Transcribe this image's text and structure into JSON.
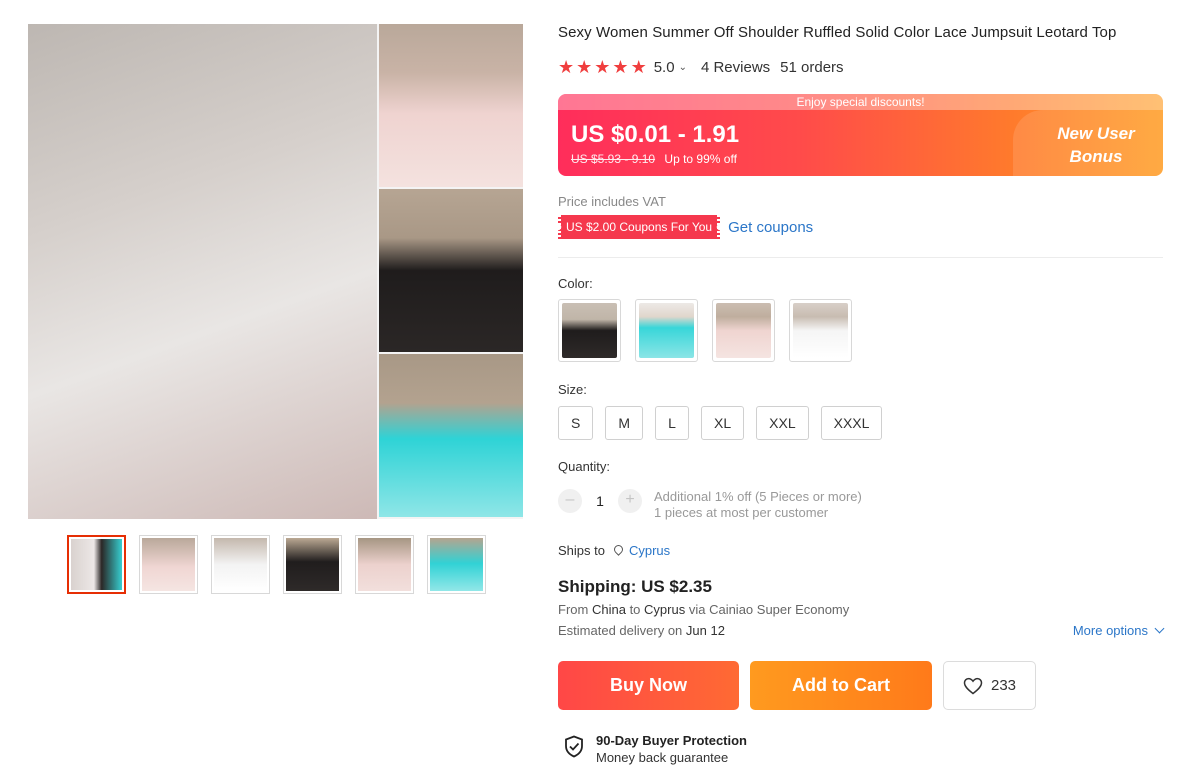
{
  "product": {
    "title": "Sexy Women Summer Off Shoulder Ruffled Solid Color Lace Jumpsuit Leotard Top",
    "rating": "5.0",
    "reviews": "4 Reviews",
    "orders": "51 orders"
  },
  "price": {
    "banner_text": "Enjoy special discounts!",
    "current": "US $0.01 - 1.91",
    "original": "US $5.93 - 9.10",
    "discount": "Up to 99% off",
    "promo_line1": "New User",
    "promo_line2": "Bonus"
  },
  "vat_note": "Price includes VAT",
  "coupon": {
    "tag": "US $2.00 Coupons For You",
    "link": "Get coupons"
  },
  "color": {
    "label": "Color:",
    "options": [
      "black",
      "aqua",
      "pink",
      "white"
    ]
  },
  "size": {
    "label": "Size:",
    "options": [
      "S",
      "M",
      "L",
      "XL",
      "XXL",
      "XXXL"
    ]
  },
  "quantity": {
    "label": "Quantity:",
    "minus": "–",
    "value": "1",
    "plus": "+",
    "note1": "Additional 1% off (5 Pieces or more)",
    "note2": "1 pieces at most per customer"
  },
  "shipping": {
    "ships_to_label": "Ships to",
    "destination": "Cyprus",
    "price": "Shipping: US $2.35",
    "route_from": "From",
    "origin": "China",
    "route_to": "to",
    "route_dest": "Cyprus",
    "route_via": "via Cainiao Super Economy",
    "delivery_label": "Estimated delivery on",
    "delivery_date": "Jun 12",
    "more_options": "More options"
  },
  "actions": {
    "buy_now": "Buy Now",
    "add_to_cart": "Add to Cart",
    "wishlist_count": "233"
  },
  "protection": {
    "title": "90-Day Buyer Protection",
    "subtitle": "Money back guarantee"
  },
  "gallery": {
    "thumbnails": [
      "mix",
      "pink",
      "white",
      "black",
      "pink",
      "aqua"
    ]
  },
  "colors": {
    "star": "#f03e3e",
    "link": "#2b76c8",
    "buy_now": "#ff4747",
    "add_to_cart": "#ff8a1c",
    "coupon": "#f5384d"
  }
}
